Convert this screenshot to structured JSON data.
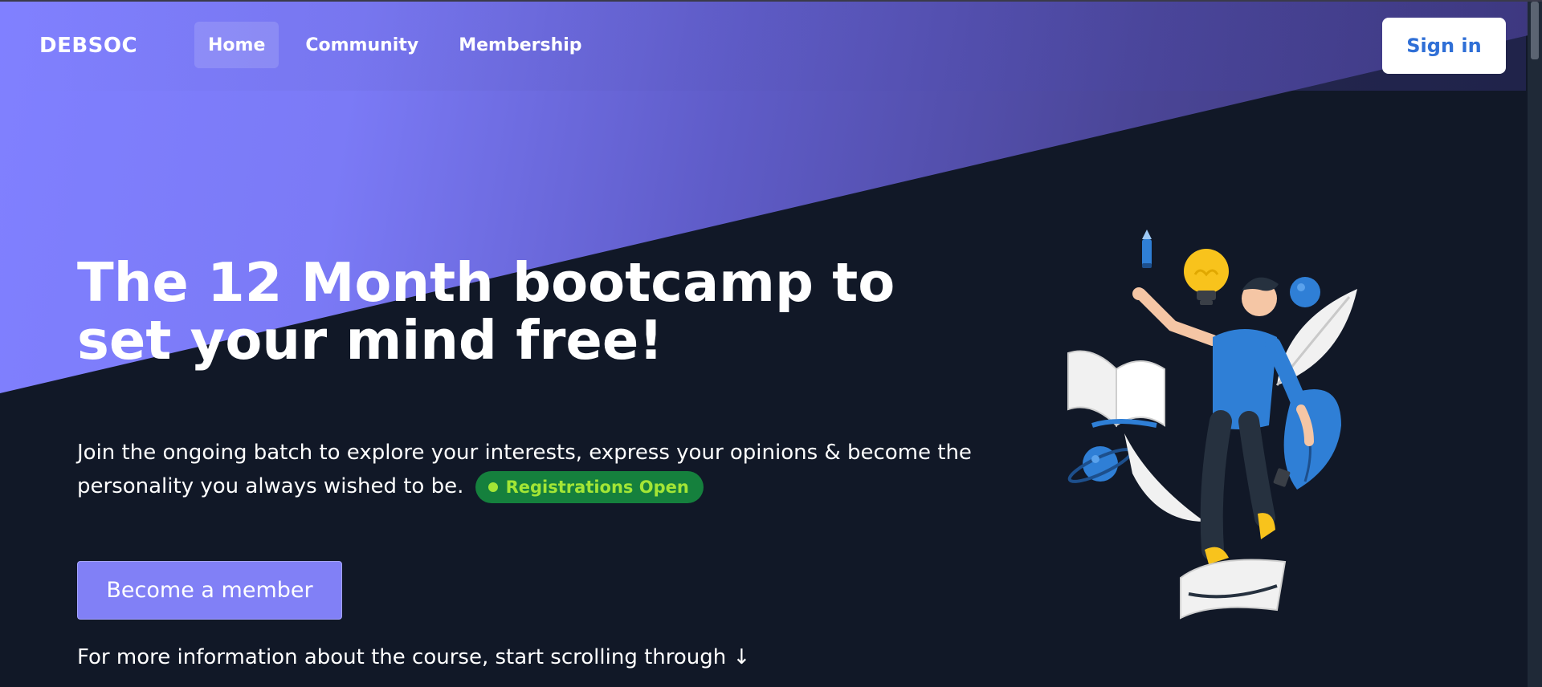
{
  "brand": {
    "logo_text": "DEBSOC"
  },
  "nav": {
    "items": [
      {
        "label": "Home",
        "active": true
      },
      {
        "label": "Community",
        "active": false
      },
      {
        "label": "Membership",
        "active": false
      }
    ],
    "signin_label": "Sign in"
  },
  "hero": {
    "title": "The 12 Month bootcamp to set your mind free!",
    "subtitle": "Join the ongoing batch to explore your interests, express your opinions & become the personality you always wished to be.",
    "badge_label": "Registrations Open",
    "cta_label": "Become a member",
    "more_info": "For more information about the course, start scrolling through ↓"
  },
  "colors": {
    "page_bg": "#111827",
    "accent_purple": "#8180f6",
    "signin_text": "#2f6fd6",
    "badge_bg": "#15803d",
    "badge_text": "#a3e635"
  },
  "illustration": {
    "icons": [
      "pencil-icon",
      "lightbulb-icon",
      "book-icon",
      "planet-icon",
      "ball-icon",
      "person-figure"
    ]
  }
}
